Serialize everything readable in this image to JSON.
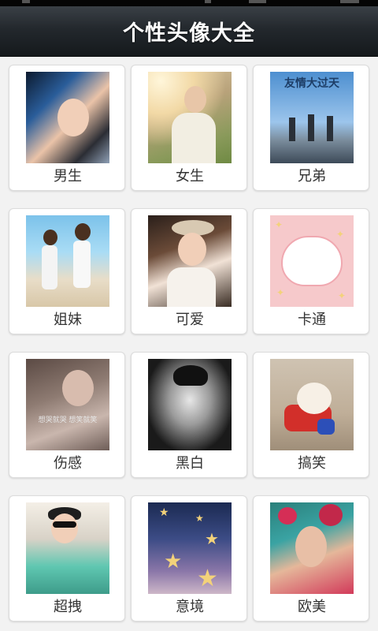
{
  "app": {
    "title": "个性头像大全"
  },
  "categories": [
    {
      "label": "男生",
      "thumb_icon": "boy-portrait-photo"
    },
    {
      "label": "女生",
      "thumb_icon": "girl-portrait-photo"
    },
    {
      "label": "兄弟",
      "thumb_icon": "friends-jumping-photo",
      "overlay_text": "友情大过天"
    },
    {
      "label": "姐妹",
      "thumb_icon": "sisters-beach-photo"
    },
    {
      "label": "可爱",
      "thumb_icon": "cute-girl-photo"
    },
    {
      "label": "卡通",
      "thumb_icon": "cartoon-pig-image"
    },
    {
      "label": "伤感",
      "thumb_icon": "sad-girl-photo",
      "overlay_text": "想哭就哭  想笑就笑"
    },
    {
      "label": "黑白",
      "thumb_icon": "black-white-photo"
    },
    {
      "label": "搞笑",
      "thumb_icon": "funny-dog-photo"
    },
    {
      "label": "超拽",
      "thumb_icon": "cool-boy-photo"
    },
    {
      "label": "意境",
      "thumb_icon": "stars-mood-image"
    },
    {
      "label": "欧美",
      "thumb_icon": "western-girl-photo"
    }
  ]
}
